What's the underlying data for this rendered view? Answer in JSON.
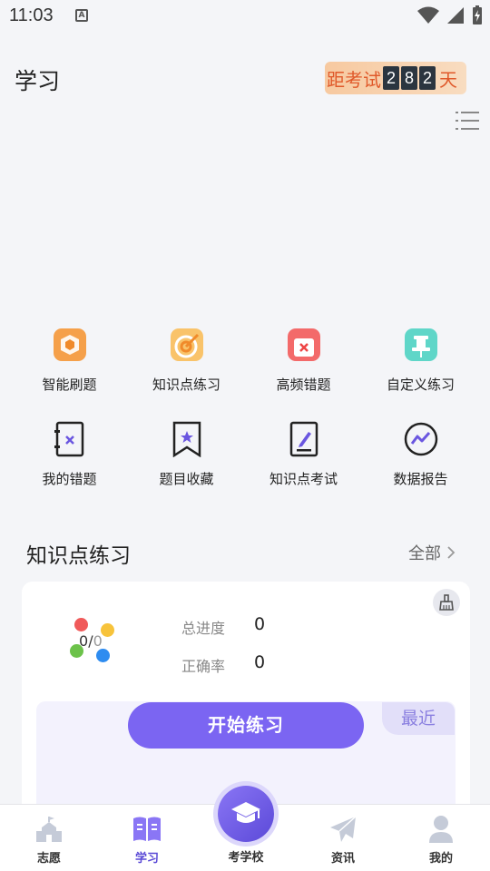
{
  "status_bar": {
    "time": "11:03",
    "notification_letter": "A"
  },
  "header": {
    "title": "学习",
    "countdown": {
      "prefix": "距考试",
      "digits": [
        "2",
        "8",
        "2"
      ],
      "suffix": "天"
    }
  },
  "grid": {
    "row1": [
      {
        "label": "智能刷题",
        "icon": "cube-icon"
      },
      {
        "label": "知识点练习",
        "icon": "target-icon"
      },
      {
        "label": "高频错题",
        "icon": "wrong-book-icon"
      },
      {
        "label": "自定义练习",
        "icon": "pin-icon"
      }
    ],
    "row2": [
      {
        "label": "我的错题",
        "icon": "notebook-x-icon"
      },
      {
        "label": "题目收藏",
        "icon": "bookmark-star-icon"
      },
      {
        "label": "知识点考试",
        "icon": "exam-pen-icon"
      },
      {
        "label": "数据报告",
        "icon": "chart-circle-icon"
      }
    ]
  },
  "section": {
    "title": "知识点练习",
    "more": "全部"
  },
  "card": {
    "progress_done": "0",
    "progress_slash": "/",
    "progress_total": "0",
    "stats": [
      {
        "label": "总进度",
        "value": "0"
      },
      {
        "label": "正确率",
        "value": "0"
      }
    ],
    "start_button": "开始练习",
    "recent_tab": "最近"
  },
  "tab_bar": {
    "tabs": [
      {
        "label": "志愿",
        "icon": "school-icon"
      },
      {
        "label": "学习",
        "icon": "book-icon",
        "active": true
      },
      {
        "label": "考学校",
        "icon": "graduation-cap-icon"
      },
      {
        "label": "资讯",
        "icon": "paper-plane-icon"
      },
      {
        "label": "我的",
        "icon": "person-icon"
      }
    ]
  },
  "colors": {
    "accent": "#7b65f2",
    "countdown_bg": "#f7c9a0",
    "countdown_text": "#e0592a",
    "page_bg": "#f4f5f8"
  }
}
